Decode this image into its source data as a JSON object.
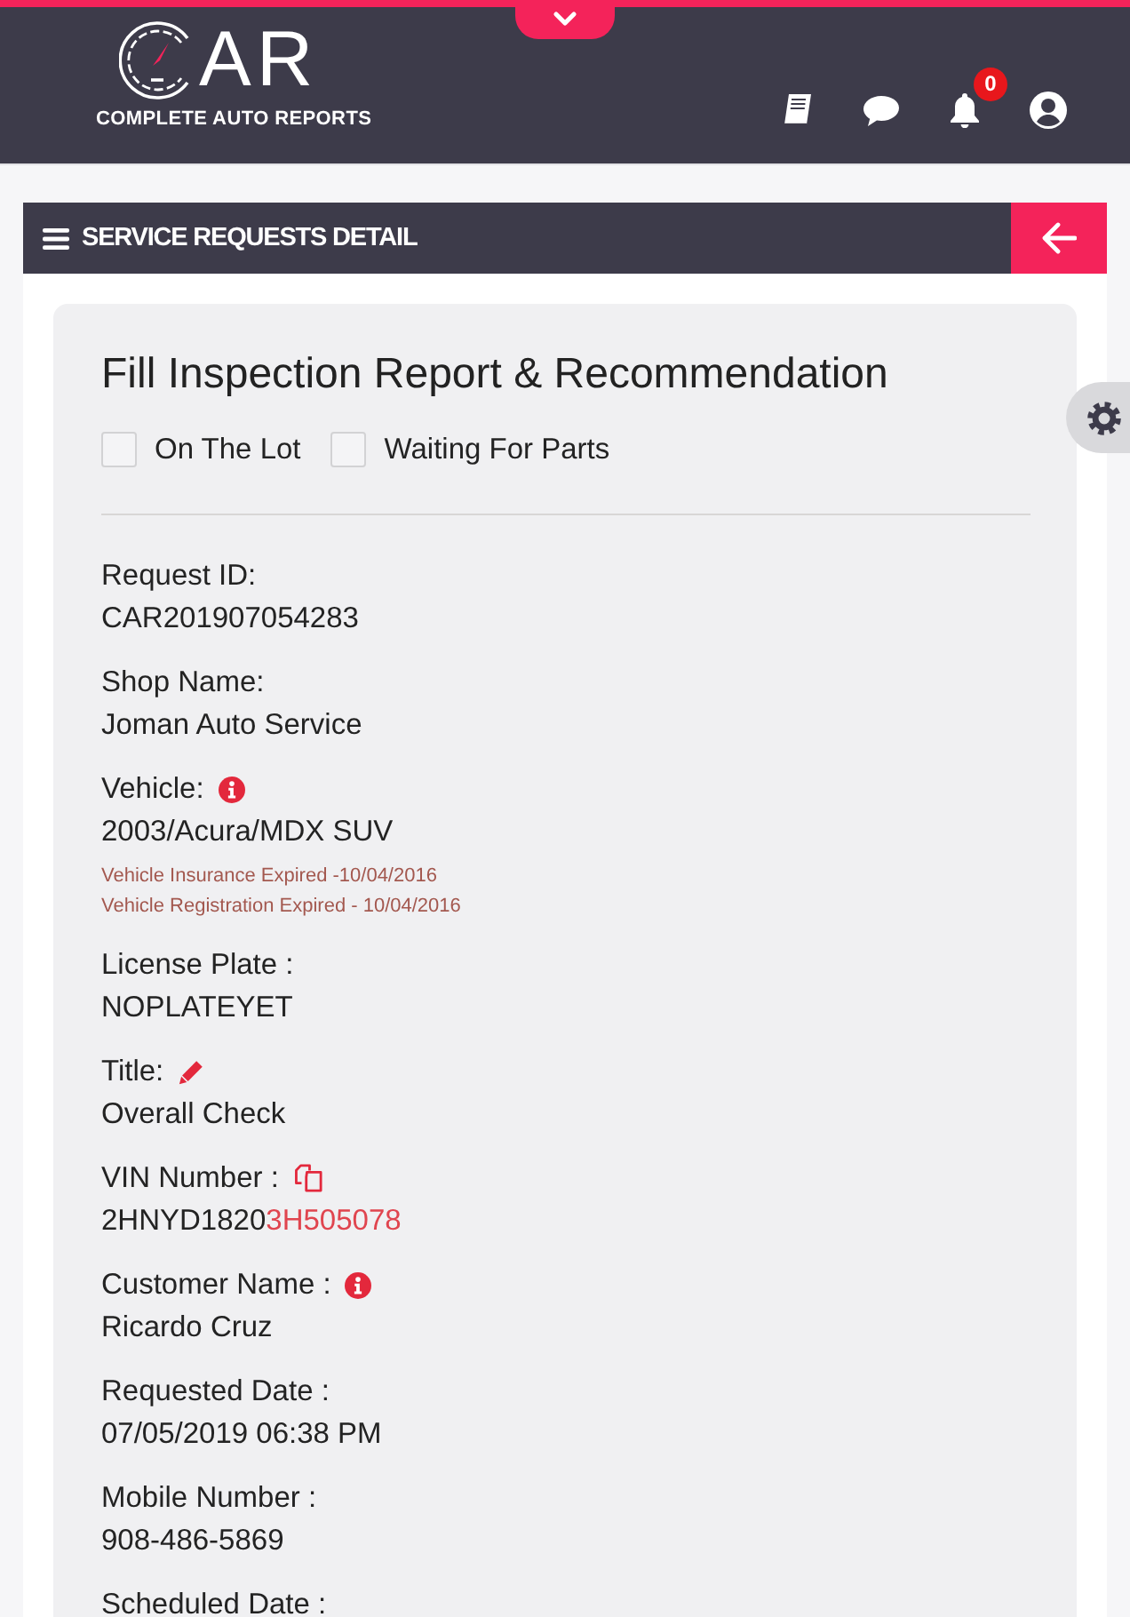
{
  "header": {
    "logo": {
      "wordmark": "AR",
      "tagline": "COMPLETE AUTO REPORTS"
    },
    "notification_count": "0"
  },
  "section": {
    "title": "SERVICE REQUESTS DETAIL"
  },
  "card": {
    "title": "Fill Inspection Report & Recommendation",
    "checkboxes": [
      {
        "label": "On The Lot",
        "checked": false
      },
      {
        "label": "Waiting For Parts",
        "checked": false
      }
    ],
    "fields": [
      {
        "kind": "plain",
        "label": "Request ID:",
        "value": "CAR201907054283"
      },
      {
        "kind": "plain",
        "label": "Shop Name:",
        "value": "Joman Auto Service"
      },
      {
        "kind": "info",
        "label": "Vehicle:",
        "value": "2003/Acura/MDX SUV",
        "notes": [
          "Vehicle Insurance Expired -10/04/2016",
          "Vehicle Registration Expired - 10/04/2016"
        ]
      },
      {
        "kind": "plain",
        "label": "License Plate :",
        "value": "NOPLATEYET"
      },
      {
        "kind": "edit",
        "label": "Title:",
        "value": "Overall Check"
      },
      {
        "kind": "copy",
        "label": "VIN Number :",
        "value": "2HNYD1820",
        "highlighted_tail": "3H505078"
      },
      {
        "kind": "info",
        "label": "Customer Name :",
        "value": "Ricardo Cruz"
      },
      {
        "kind": "plain",
        "label": "Requested Date :",
        "value": "07/05/2019 06:38 PM"
      },
      {
        "kind": "plain",
        "label": "Mobile Number :",
        "value": "908-486-5869"
      },
      {
        "kind": "plain",
        "label": "Scheduled Date :"
      }
    ]
  }
}
